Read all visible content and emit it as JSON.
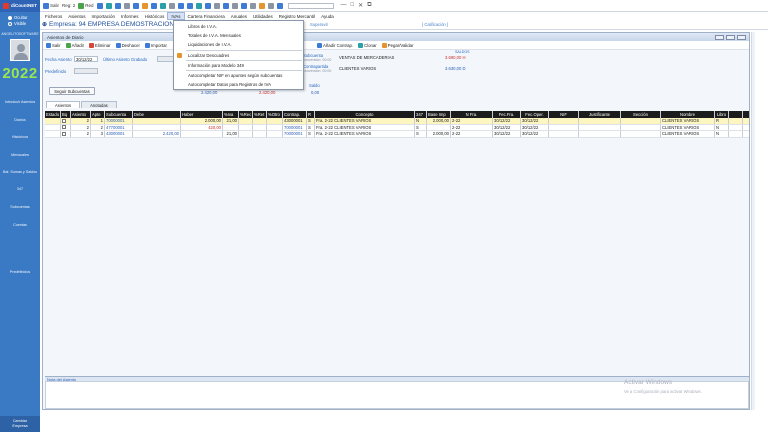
{
  "app": {
    "brand": "diCountNET"
  },
  "toolbar": {
    "items": [
      {
        "label": "Salir"
      },
      {
        "label": "Reg: 2"
      },
      {
        "label": "Red"
      }
    ]
  },
  "sidebar": {
    "radio_ocultar": "Ocultar",
    "radio_visible": "Visible",
    "user": "ANGELITOSOFTWARE",
    "year": "2022",
    "items": [
      "Introducir Asientos",
      "Diarios",
      "Históricos",
      "Mensuales",
      "Bal. Sumas y Saldos",
      "347",
      "Subcuentas",
      "Cuentas",
      "Predefinidos"
    ],
    "footer_line1": "Cambiar",
    "footer_line2": "Empresa"
  },
  "menubar": {
    "items": [
      "Ficheros",
      "Asientos",
      "Importación",
      "Informes",
      "Históricos",
      "IVAs",
      "Cartera Financiera",
      "Anuales",
      "Utilidades",
      "Registro Mercantil",
      "Ayuda"
    ],
    "active": "IVAs"
  },
  "company": {
    "title": "Empresa: 94  EMPRESA DEMOSTRACION",
    "extra1": "Superavit",
    "extra2": "[ Calificación ]"
  },
  "document": {
    "title": "Asientos de Diario",
    "toolbar": [
      "Salir",
      "Añadir",
      "Eliminar",
      "Deshacer",
      "Importar",
      "Añadir Contrap.",
      "Clonar",
      "Pegar/Validar"
    ],
    "form": {
      "fecha_label": "Fecha Asiento",
      "fecha_value": "30/12/22",
      "ultimo_label": "Último Asiento Grabado",
      "predefinido_label": "Predefinido",
      "subcuenta_label": "Subcuenta",
      "subcuenta_value": "VENTAS DE MERCADERIAS",
      "subcuenta_sub": "conversión: 00:00",
      "contrapartida_label": "Contrapartida",
      "contrapartida_value": "CLIENTES VARIOS",
      "contrapartida_sub": "conversión: 00:00",
      "saldos_label": "SALDOS",
      "saldo1": "3.690,00 H",
      "saldo2": "3.630,00 D",
      "debe_total": "2.420,00",
      "haber_total": "2.420,00",
      "saldo_total": "0,00",
      "saldo_total_label": "Saldo",
      "buscar_subcuentas": "Seguir Subcuentas"
    },
    "tabs": [
      "Asientos",
      "Anotadas"
    ],
    "grid": {
      "columns": [
        "Estado",
        "Bq",
        "Asiento",
        "Apte",
        "Subcuenta",
        "Debe",
        "Haber",
        "%Iva",
        "%Rec",
        "%Ret",
        "%Otro",
        "Contrap.",
        "R",
        "Concepto",
        "347",
        "Base Imp",
        "N Fra.",
        "Fec.Fra.",
        "Fec.Oper.",
        "NIF",
        "Justificante",
        "Sección",
        "Nombre",
        "Libro",
        ""
      ],
      "rows": [
        {
          "asiento": "2",
          "apte": "1",
          "subcuenta": "70000001",
          "debe": "",
          "haber": "2.000,00",
          "iva": "21,00",
          "contrap": "43000001",
          "r": "S",
          "concepto": "Fra. 2-22 CLIENTES VARIOS",
          "c347": "N",
          "base": "2.000,00",
          "nfra": "2-22",
          "fecfra": "30/12/22",
          "fecoper": "30/12/22",
          "nombre": "CLIENTES VARIOS",
          "libro": "R"
        },
        {
          "asiento": "2",
          "apte": "2",
          "subcuenta": "47700001",
          "debe": "",
          "haber": "420,00",
          "iva": "",
          "contrap": "70000001",
          "r": "S",
          "concepto": "Fra. 2-22 CLIENTES VARIOS",
          "c347": "S",
          "base": "",
          "nfra": "2-22",
          "fecfra": "30/12/22",
          "fecoper": "30/12/22",
          "nombre": "CLIENTES VARIOS",
          "libro": "N"
        },
        {
          "asiento": "2",
          "apte": "3",
          "subcuenta": "43000001",
          "debe": "2.420,00",
          "haber": "",
          "iva": "21,00",
          "contrap": "70000001",
          "r": "S",
          "concepto": "Fra. 2-22 CLIENTES VARIOS",
          "c347": "S",
          "base": "2.000,00",
          "nfra": "2-22",
          "fecfra": "30/12/22",
          "fecoper": "30/12/22",
          "nombre": "CLIENTES VARIOS",
          "libro": "N"
        }
      ]
    },
    "notes_label": "Nota del Asiento"
  },
  "dropdown": {
    "items": [
      "Libros de I.V.A.",
      "Totales de I.V.A. Mensuales",
      "Liquidaciones de I.V.A.",
      "Localizar Descuadres",
      "Información para Modelo 349",
      "Autocompletar NIF en apuntes según subcuentas",
      "Autocompletar Datos para Registros de IVA"
    ]
  },
  "watermark": {
    "line1": "Activar Windows",
    "line2": "Ve a Configuración para activar Windows."
  }
}
